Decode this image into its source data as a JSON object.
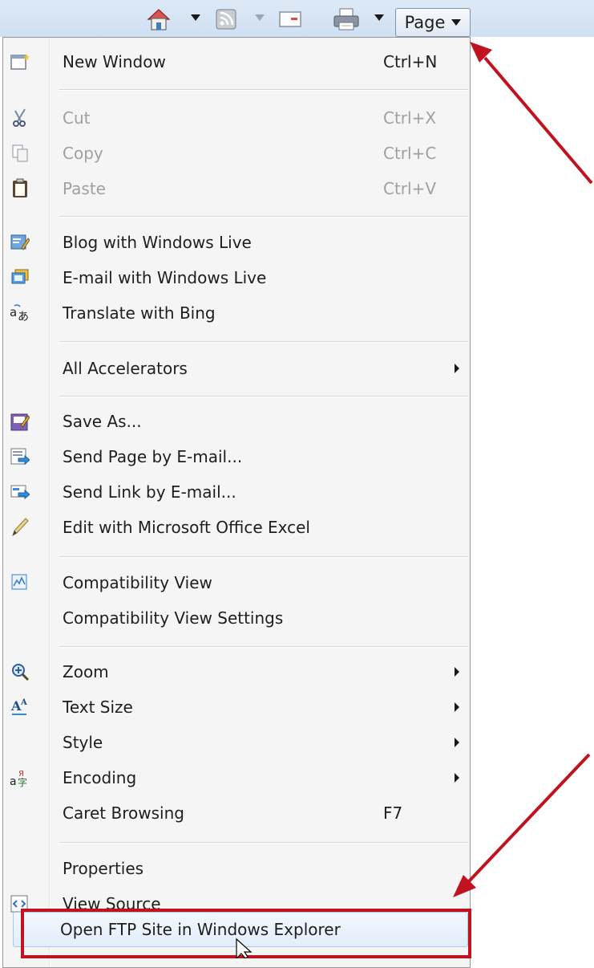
{
  "toolbar": {
    "page_label": "Page",
    "icons": [
      "home-icon",
      "rss-feed-icon",
      "read-mail-icon",
      "print-icon"
    ]
  },
  "menu": {
    "items": [
      {
        "label": "New Window",
        "shortcut": "Ctrl+N"
      },
      {
        "label": "Cut",
        "shortcut": "Ctrl+X"
      },
      {
        "label": "Copy",
        "shortcut": "Ctrl+C"
      },
      {
        "label": "Paste",
        "shortcut": "Ctrl+V"
      },
      {
        "label": "Blog with Windows Live"
      },
      {
        "label": "E-mail with Windows Live"
      },
      {
        "label": "Translate with Bing"
      },
      {
        "label": "All Accelerators"
      },
      {
        "label": "Save As..."
      },
      {
        "label": "Send Page by E-mail..."
      },
      {
        "label": "Send Link by E-mail..."
      },
      {
        "label": "Edit with Microsoft Office Excel"
      },
      {
        "label": "Compatibility View"
      },
      {
        "label": "Compatibility View Settings"
      },
      {
        "label": "Zoom"
      },
      {
        "label": "Text Size"
      },
      {
        "label": "Style"
      },
      {
        "label": "Encoding"
      },
      {
        "label": "Caret Browsing",
        "shortcut": "F7"
      },
      {
        "label": "Properties"
      },
      {
        "label": "View Source"
      },
      {
        "label": "Open FTP Site in Windows Explorer"
      }
    ]
  },
  "colors": {
    "annotation_red": "#c1121f",
    "highlight_border": "#a8c8ec",
    "disabled_text": "#a0a0a0"
  }
}
